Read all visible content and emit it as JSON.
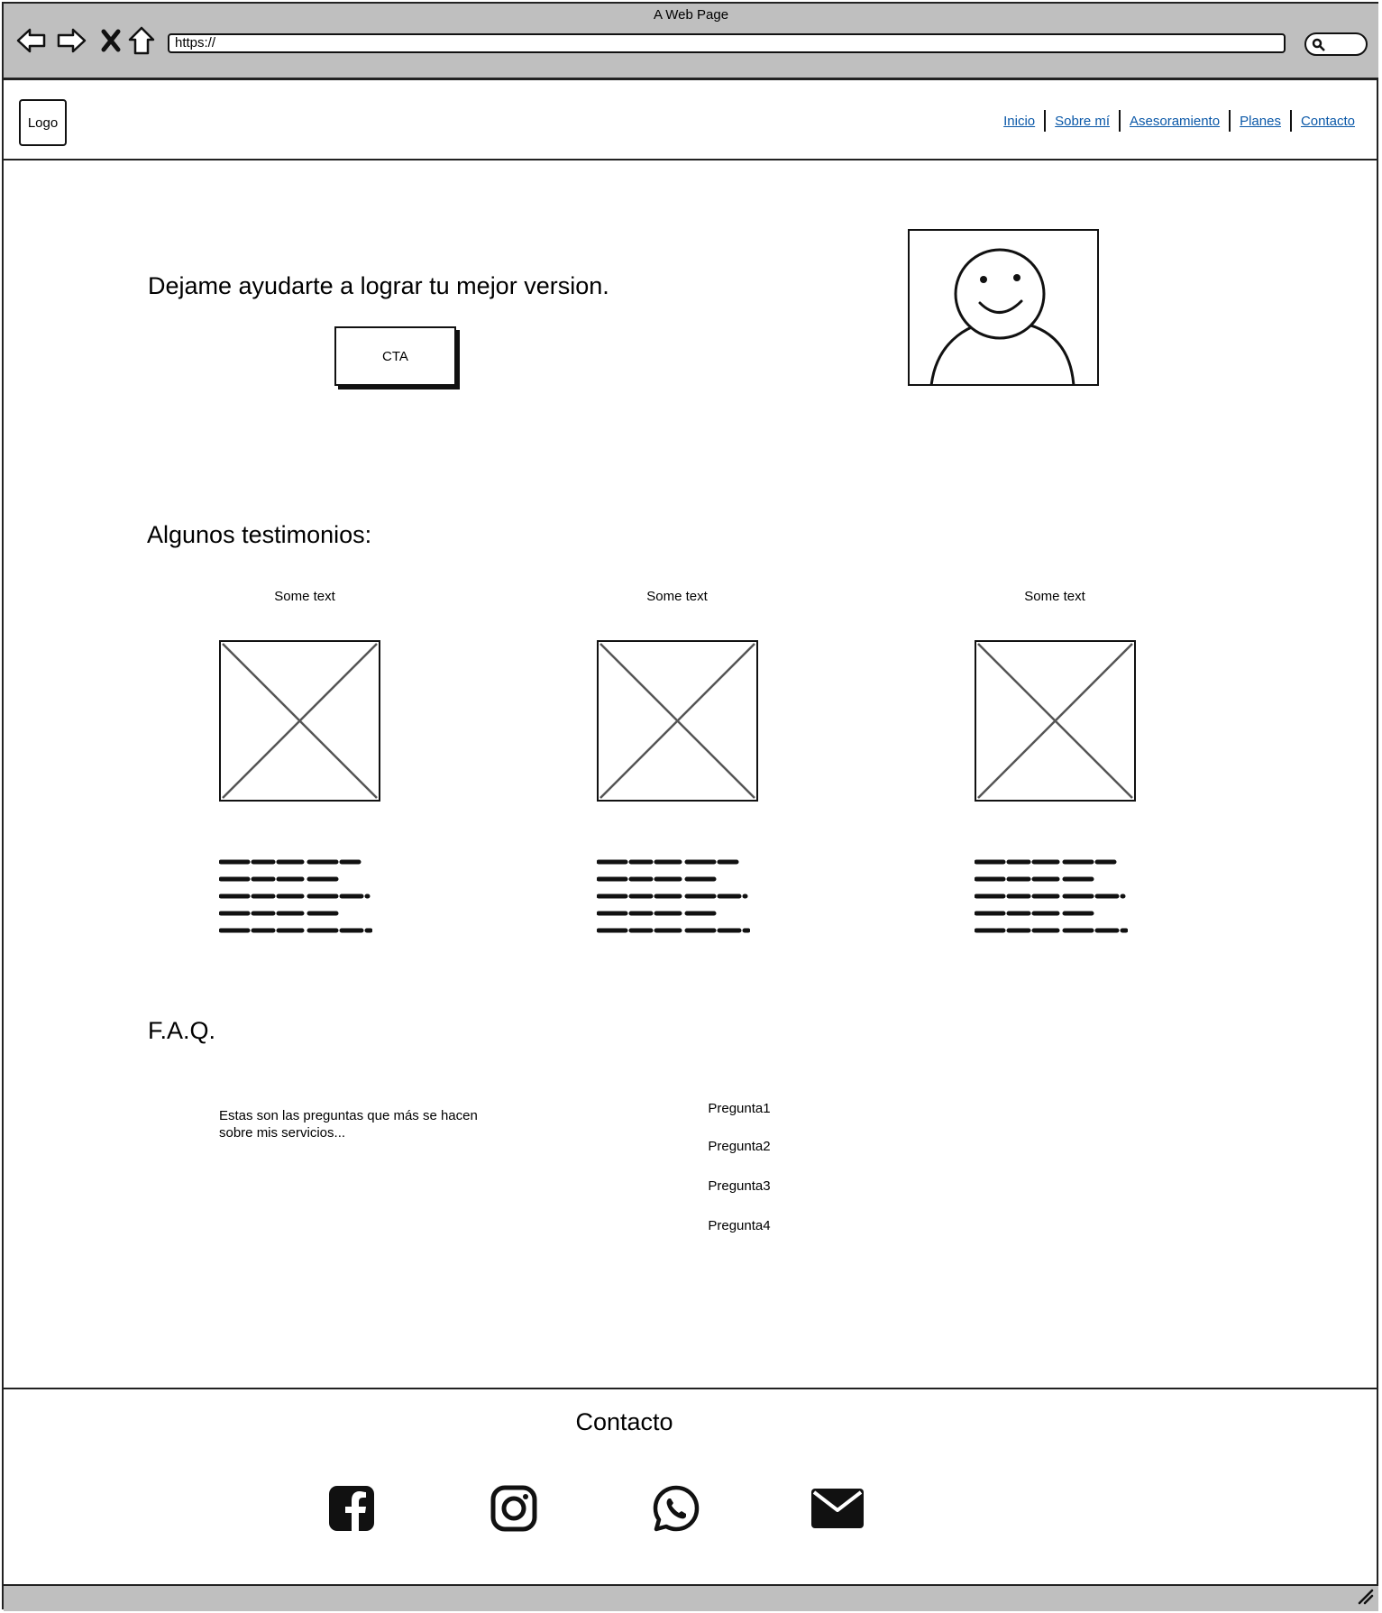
{
  "browser": {
    "title": "A Web Page",
    "url": "https://"
  },
  "header": {
    "logo": "Logo",
    "nav": [
      "Inicio",
      "Sobre mí",
      "Asesoramiento",
      "Planes",
      "Contacto"
    ]
  },
  "hero": {
    "heading": "Dejame ayudarte a lograr tu mejor version.",
    "cta": "CTA"
  },
  "testimonials": {
    "heading": "Algunos testimonios:",
    "items": [
      {
        "title": "Some text"
      },
      {
        "title": "Some text"
      },
      {
        "title": "Some text"
      }
    ]
  },
  "faq": {
    "heading": "F.A.Q.",
    "intro": "Estas son las preguntas que más se hacen sobre mis servicios...",
    "questions": [
      "Pregunta1",
      "Pregunta2",
      "Pregunta3",
      "Pregunta4"
    ]
  },
  "footer": {
    "heading": "Contacto",
    "icons": [
      "facebook-icon",
      "instagram-icon",
      "whatsapp-icon",
      "email-icon"
    ]
  }
}
